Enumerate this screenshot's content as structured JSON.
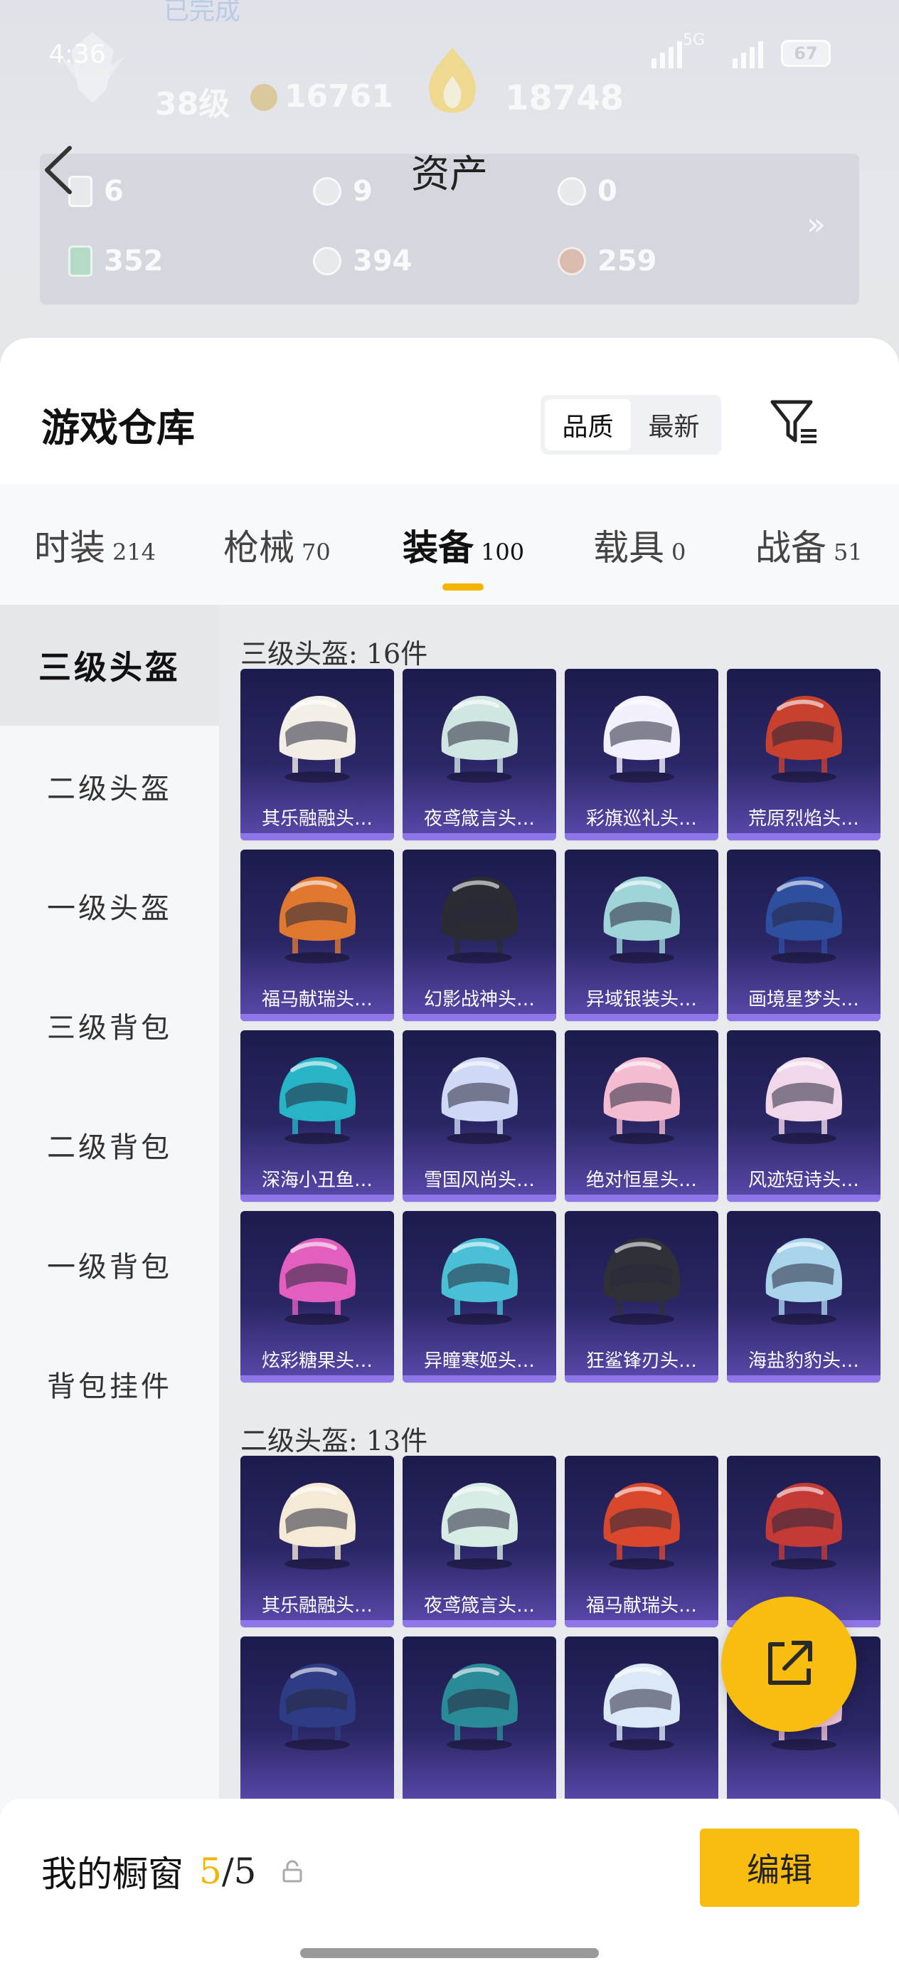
{
  "status_bar": {
    "time": "4:36",
    "network": "5G",
    "battery": "67"
  },
  "profile_bg": {
    "top_partial_text": "已完成",
    "level": "38级",
    "points": "16761",
    "medal_score": "18748"
  },
  "header": {
    "title": "资产"
  },
  "assets": {
    "row1": [
      {
        "value": "6"
      },
      {
        "value": "9"
      },
      {
        "value": "0"
      }
    ],
    "row2": [
      {
        "value": "352"
      },
      {
        "value": "394"
      },
      {
        "value": "259"
      }
    ],
    "more_icon": "double-chevron-right-icon"
  },
  "warehouse": {
    "title": "游戏仓库",
    "sort_options": [
      "品质",
      "最新"
    ],
    "filter_icon": "filter-icon"
  },
  "tabs": [
    {
      "label": "时装",
      "count": "214"
    },
    {
      "label": "枪械",
      "count": "70"
    },
    {
      "label": "装备",
      "count": "100"
    },
    {
      "label": "载具",
      "count": "0"
    },
    {
      "label": "战备",
      "count": "51"
    }
  ],
  "active_tab": "装备",
  "accent_color": "#f4b400",
  "sidebar": [
    "三级头盔",
    "二级头盔",
    "一级头盔",
    "三级背包",
    "二级背包",
    "一级背包",
    "背包挂件"
  ],
  "groups": [
    {
      "label": "三级头盔: 16件",
      "items": [
        {
          "name": "其乐融融头…",
          "color": "#f3efe6"
        },
        {
          "name": "夜鸢箴言头…",
          "color": "#cfe6e2"
        },
        {
          "name": "彩旗巡礼头…",
          "color": "#f1f0fb"
        },
        {
          "name": "荒原烈焰头…",
          "color": "#c8412e"
        },
        {
          "name": "福马献瑞头…",
          "color": "#e0782f"
        },
        {
          "name": "幻影战神头…",
          "color": "#2b2b33"
        },
        {
          "name": "异域银装头…",
          "color": "#9fd4d8"
        },
        {
          "name": "画境星梦头…",
          "color": "#2e4ea0"
        },
        {
          "name": "深海小丑鱼…",
          "color": "#26b4c6"
        },
        {
          "name": "雪国风尚头…",
          "color": "#cfd9f5"
        },
        {
          "name": "绝对恒星头…",
          "color": "#f3bcd1"
        },
        {
          "name": "风迹短诗头…",
          "color": "#f0d8ea"
        },
        {
          "name": "炫彩糖果头…",
          "color": "#e35fbf"
        },
        {
          "name": "异瞳寒姬头…",
          "color": "#4ac0d6"
        },
        {
          "name": "狂鲨锋刃头…",
          "color": "#2f3038"
        },
        {
          "name": "海盐豹豹头…",
          "color": "#a9d4ec"
        }
      ]
    },
    {
      "label": "二级头盔: 13件",
      "items": [
        {
          "name": "其乐融融头…",
          "color": "#f4ead6"
        },
        {
          "name": "夜鸢箴言头…",
          "color": "#d8ece6"
        },
        {
          "name": "福马献瑞头…",
          "color": "#d9472d"
        },
        {
          "name": "",
          "color": "#c33a36"
        },
        {
          "name": "",
          "color": "#2d3c84"
        },
        {
          "name": "",
          "color": "#2a8b98"
        },
        {
          "name": "",
          "color": "#dbe9f6"
        },
        {
          "name": "",
          "color": "#f2c6d7"
        }
      ]
    }
  ],
  "fab_icon": "external-link-icon",
  "showcase": {
    "label": "我的橱窗",
    "current": "5",
    "separator": "/",
    "total": "5",
    "lock_icon": "lock-icon"
  },
  "edit_button": "编辑"
}
